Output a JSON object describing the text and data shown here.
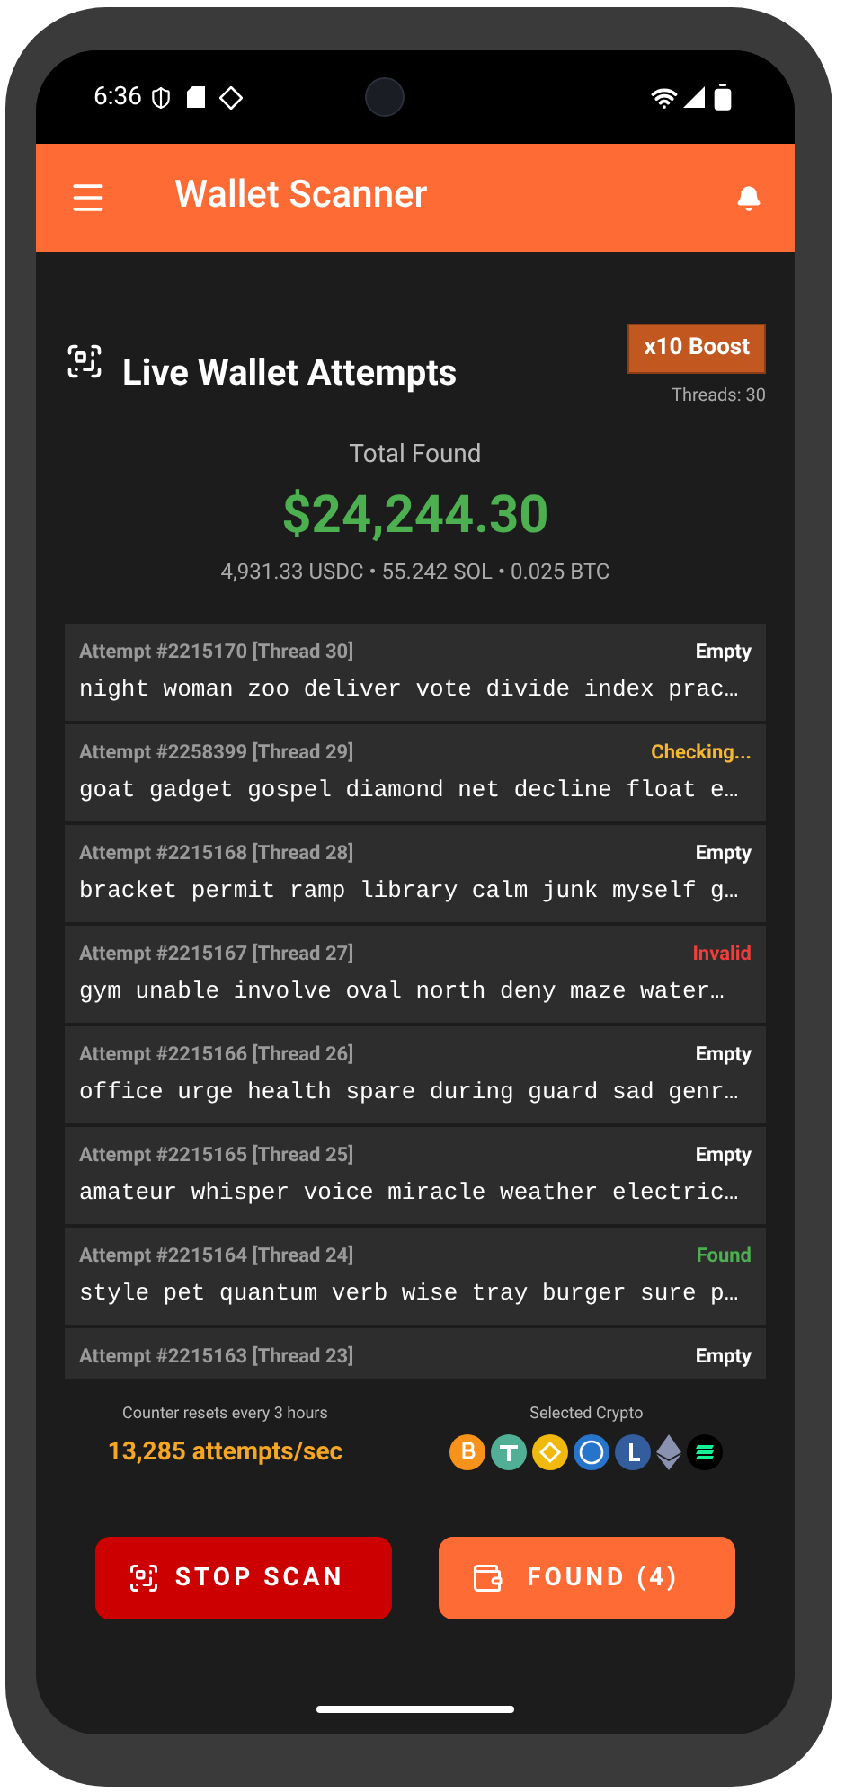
{
  "status_bar": {
    "time": "6:36"
  },
  "app_bar": {
    "title": "Wallet Scanner"
  },
  "header": {
    "title": "Live Wallet Attempts",
    "boost": "x10 Boost",
    "threads": "Threads: 30"
  },
  "summary": {
    "label": "Total Found",
    "amount": "$24,244.30",
    "breakdown": "4,931.33 USDC • 55.242 SOL • 0.025 BTC"
  },
  "attempts": [
    {
      "title": "Attempt #2215170 [Thread 30]",
      "status": "Empty",
      "color": "#ffffff",
      "phrase": "night woman zoo deliver vote divide index prac…"
    },
    {
      "title": "Attempt #2258399 [Thread 29]",
      "status": "Checking...",
      "color": "#f5b731",
      "phrase": "goat gadget gospel diamond net decline float e…"
    },
    {
      "title": "Attempt #2215168 [Thread 28]",
      "status": "Empty",
      "color": "#ffffff",
      "phrase": "bracket permit ramp library calm junk myself g…"
    },
    {
      "title": "Attempt #2215167 [Thread 27]",
      "status": "Invalid",
      "color": "#f03e3e",
      "phrase": "gym unable involve oval north deny maze water…"
    },
    {
      "title": "Attempt #2215166 [Thread 26]",
      "status": "Empty",
      "color": "#ffffff",
      "phrase": "office urge health spare during guard sad genr…"
    },
    {
      "title": "Attempt #2215165 [Thread 25]",
      "status": "Empty",
      "color": "#ffffff",
      "phrase": "amateur whisper voice miracle weather electric…"
    },
    {
      "title": "Attempt #2215164 [Thread 24]",
      "status": "Found",
      "color": "#4caf50",
      "phrase": "style pet quantum verb wise tray burger sure p…"
    },
    {
      "title": "Attempt #2215163 [Thread 23]",
      "status": "Empty",
      "color": "#ffffff"
    }
  ],
  "footer": {
    "counter_note": "Counter resets every 3 hours",
    "rate": "13,285 attempts/sec",
    "crypto_label": "Selected Crypto"
  },
  "buttons": [
    {
      "kind": "stop",
      "label": "STOP SCAN"
    },
    {
      "kind": "found",
      "label": "FOUND (4)"
    }
  ]
}
